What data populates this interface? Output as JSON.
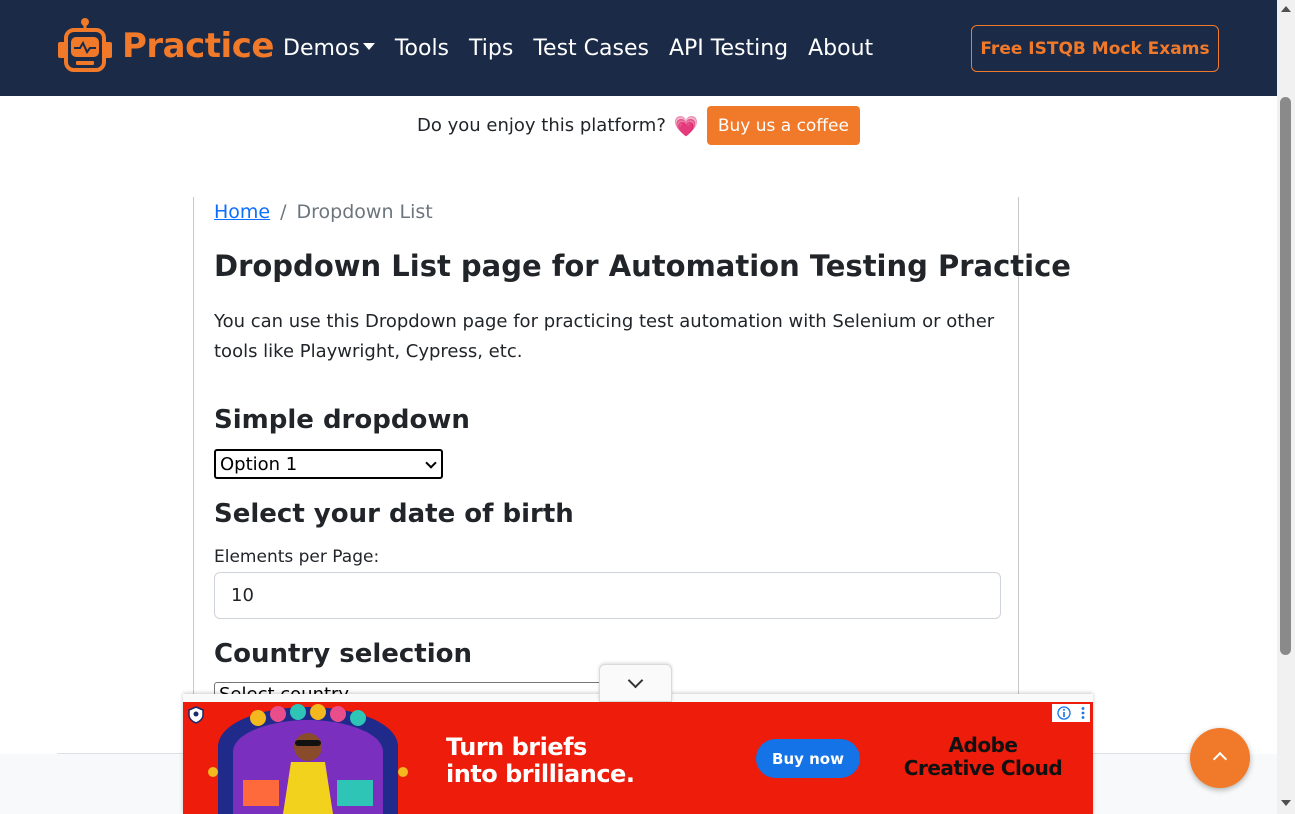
{
  "navbar": {
    "brand": "Practice",
    "links": [
      "Demos",
      "Tools",
      "Tips",
      "Test Cases",
      "API Testing",
      "About"
    ],
    "cta": "Free ISTQB Mock Exams"
  },
  "banner": {
    "question": "Do you enjoy this platform?",
    "heart": "💗",
    "button": "Buy us a coffee"
  },
  "breadcrumb": {
    "home": "Home",
    "separator": "/",
    "current": "Dropdown List"
  },
  "main": {
    "title": "Dropdown List page for Automation Testing Practice",
    "intro": "You can use this Dropdown page for practicing test automation with Selenium or other tools like Playwright, Cypress, etc.",
    "simple": {
      "heading": "Simple dropdown",
      "selected": "Option 1"
    },
    "dob": {
      "heading": "Select your date of birth",
      "label": "Elements per Page:",
      "value": "10"
    },
    "country": {
      "heading": "Country selection",
      "selected": "Select country"
    }
  },
  "ad": {
    "headline_line1": "Turn briefs",
    "headline_line2": "into brilliance.",
    "cta": "Buy now",
    "brand_line1": "Adobe",
    "brand_line2": "Creative Cloud"
  },
  "colors": {
    "navbar": "#1b2a47",
    "accent": "#f0792a",
    "link": "#0d6efd",
    "ad_bg": "#ed1c0b",
    "ad_cta": "#1473e6"
  }
}
